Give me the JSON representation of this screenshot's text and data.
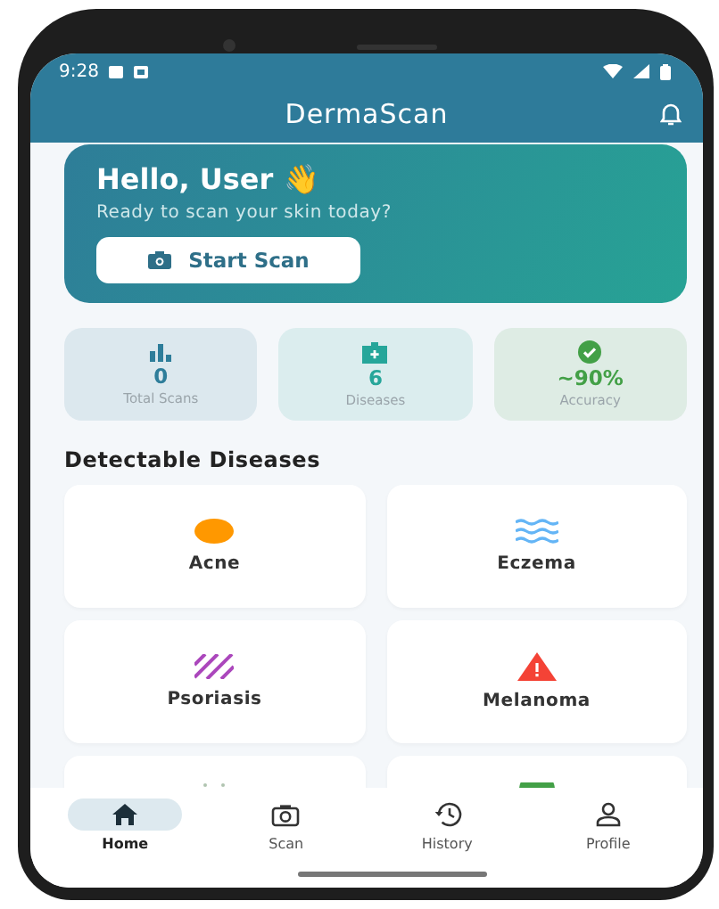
{
  "status_bar": {
    "time": "9:28"
  },
  "app_bar": {
    "title": "DermaScan"
  },
  "hero": {
    "greeting": "Hello, User",
    "wave": "👋",
    "subtitle": "Ready to scan your skin today?",
    "button": "Start Scan"
  },
  "stats": [
    {
      "kind": "chart",
      "value": "0",
      "label": "Total Scans",
      "color": "#2e7d9a"
    },
    {
      "kind": "kit",
      "value": "6",
      "label": "Diseases",
      "color": "#26a69a"
    },
    {
      "kind": "check",
      "value": "~90%",
      "label": "Accuracy",
      "color": "#43a047"
    }
  ],
  "section_title": "Detectable Diseases",
  "diseases": [
    {
      "kind": "dot",
      "label": "Acne"
    },
    {
      "kind": "waves",
      "label": "Eczema"
    },
    {
      "kind": "stripes",
      "label": "Psoriasis"
    },
    {
      "kind": "warning",
      "label": "Melanoma"
    },
    {
      "kind": "partial_dots"
    },
    {
      "kind": "partial_green"
    }
  ],
  "nav": [
    {
      "kind": "home",
      "label": "Home",
      "selected": true
    },
    {
      "kind": "camera",
      "label": "Scan",
      "selected": false
    },
    {
      "kind": "history",
      "label": "History",
      "selected": false
    },
    {
      "kind": "person",
      "label": "Profile",
      "selected": false
    }
  ]
}
